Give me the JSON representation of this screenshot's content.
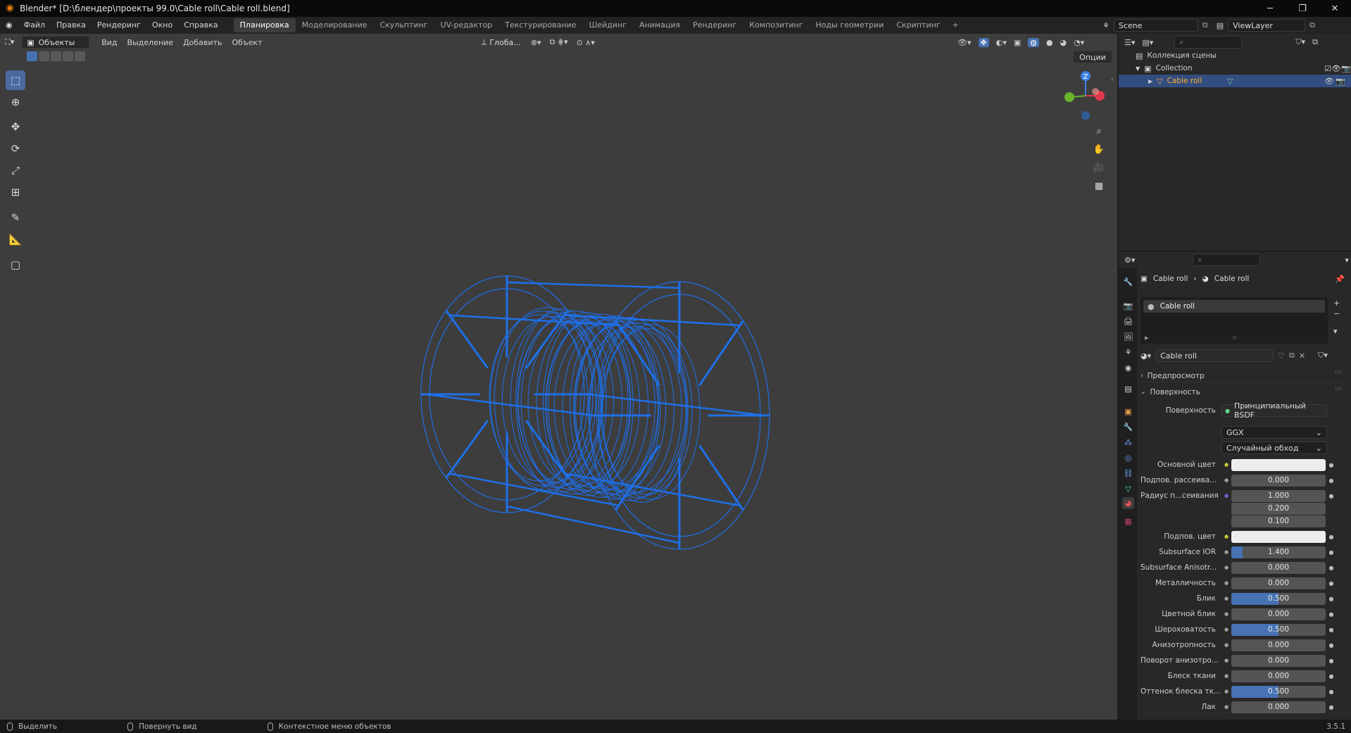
{
  "window": {
    "title": "Blender* [D:\\блендер\\проекты 99.0\\Cable roll\\Cable roll.blend]",
    "minimize": "─",
    "maximize": "❐",
    "close": "✕"
  },
  "menu": [
    "Файл",
    "Правка",
    "Рендеринг",
    "Окно",
    "Справка"
  ],
  "workspaces": [
    "Планировка",
    "Моделирование",
    "Скульптинг",
    "UV-редактор",
    "Текстурирование",
    "Шейдинг",
    "Анимация",
    "Рендеринг",
    "Композитинг",
    "Ноды геометрии",
    "Скриптинг"
  ],
  "active_workspace_index": 0,
  "add_workspace": "+",
  "scene": {
    "label": "Scene",
    "viewlayer": "ViewLayer"
  },
  "viewport_header": {
    "mode": "Объекты",
    "view": "Вид",
    "select": "Выделение",
    "add": "Добавить",
    "object": "Объект",
    "orientation": "Глоба...",
    "options": "Опции"
  },
  "gizmo": {
    "z": "Z",
    "x": "",
    "y": ""
  },
  "outliner": {
    "scene_collection": "Коллекция сцены",
    "collection": "Collection",
    "object": "Cable roll"
  },
  "properties": {
    "breadcrumb_object": "Cable roll",
    "breadcrumb_material": "Cable roll",
    "slot": "Cable roll",
    "material_name": "Cable roll",
    "panel_preview": "Предпросмотр",
    "panel_surface": "Поверхность",
    "surface_label": "Поверхность",
    "surface_value": "Принципиальный BSDF",
    "distribution": "GGX",
    "subsurface_method": "Случайный обход",
    "fields": [
      {
        "label": "Основной цвет",
        "value": "",
        "type": "color"
      },
      {
        "label": "Подпов. рассеива...",
        "value": "0.000",
        "fill": 0
      },
      {
        "label": "Радиус п...сеивания",
        "value": "1.000",
        "fill": 0
      },
      {
        "label": "",
        "value": "0.200",
        "fill": 0
      },
      {
        "label": "",
        "value": "0.100",
        "fill": 0
      },
      {
        "label": "Подпов. цвет",
        "value": "",
        "type": "color"
      },
      {
        "label": "Subsurface IOR",
        "value": "1.400",
        "fill": 0.12
      },
      {
        "label": "Subsurface Anisotr...",
        "value": "0.000",
        "fill": 0
      },
      {
        "label": "Металличность",
        "value": "0.000",
        "fill": 0
      },
      {
        "label": "Блик",
        "value": "0.500",
        "fill": 0.5
      },
      {
        "label": "Цветной блик",
        "value": "0.000",
        "fill": 0
      },
      {
        "label": "Шероховатость",
        "value": "0.500",
        "fill": 0.5
      },
      {
        "label": "Анизотропность",
        "value": "0.000",
        "fill": 0
      },
      {
        "label": "Поворот анизотро...",
        "value": "0.000",
        "fill": 0
      },
      {
        "label": "Блеск ткани",
        "value": "0.000",
        "fill": 0
      },
      {
        "label": "Оттенок блеска тк...",
        "value": "0.500",
        "fill": 0.5
      },
      {
        "label": "Лак",
        "value": "0.000",
        "fill": 0
      }
    ]
  },
  "statusbar": {
    "select": "Выделить",
    "rotate": "Повернуть вид",
    "context": "Контекстное меню объектов",
    "version": "3.5.1"
  },
  "colors": {
    "accent": "#4772b3",
    "wire": "#1f6fe8",
    "viewport": "#3d3d3d"
  }
}
